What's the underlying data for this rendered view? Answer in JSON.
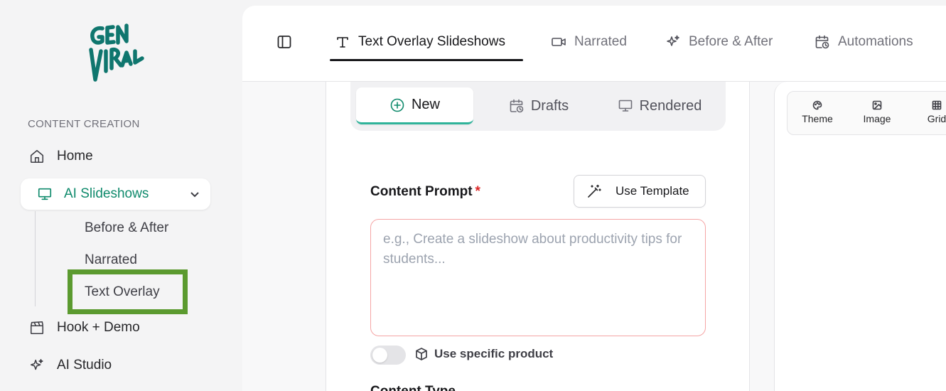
{
  "brand": {
    "logo_line1": "GEN",
    "logo_line2": "VIRAL",
    "color": "#0f766e"
  },
  "sidebar": {
    "section_label": "CONTENT CREATION",
    "items": [
      {
        "label": "Home",
        "icon": "home-icon"
      },
      {
        "label": "AI Slideshows",
        "icon": "presentation-icon",
        "active": true
      },
      {
        "label": "Hook + Demo",
        "icon": "clapperboard-icon"
      },
      {
        "label": "AI Studio",
        "icon": "sparkles-icon"
      }
    ],
    "sub_items": [
      {
        "label": "Before & After"
      },
      {
        "label": "Narrated"
      },
      {
        "label": "Text Overlay",
        "highlighted": true
      }
    ],
    "accent_color": "#0f8a6c",
    "highlight_color": "#5b9a2f"
  },
  "topbar": {
    "tabs": [
      {
        "label": "Text Overlay Slideshows",
        "icon": "text-icon",
        "active": true
      },
      {
        "label": "Narrated",
        "icon": "video-icon"
      },
      {
        "label": "Before & After",
        "icon": "sparkles-icon"
      },
      {
        "label": "Automations",
        "icon": "calendar-clock-icon"
      }
    ]
  },
  "segmented": {
    "options": [
      {
        "label": "New",
        "icon": "plus-circle-icon",
        "active": true
      },
      {
        "label": "Drafts",
        "icon": "calendar-clock-icon"
      },
      {
        "label": "Rendered",
        "icon": "monitor-icon"
      }
    ]
  },
  "form": {
    "prompt_label": "Content Prompt",
    "required_mark": "*",
    "template_button": "Use Template",
    "prompt_placeholder": "e.g., Create a slideshow about productivity tips for students...",
    "prompt_value": "",
    "product_toggle_label": "Use specific product",
    "product_toggle_on": false,
    "content_type_label": "Content Type"
  },
  "preview": {
    "tools": [
      {
        "label": "Theme",
        "icon": "palette-icon"
      },
      {
        "label": "Image",
        "icon": "image-icon"
      },
      {
        "label": "Grid",
        "icon": "grid-icon"
      }
    ]
  }
}
